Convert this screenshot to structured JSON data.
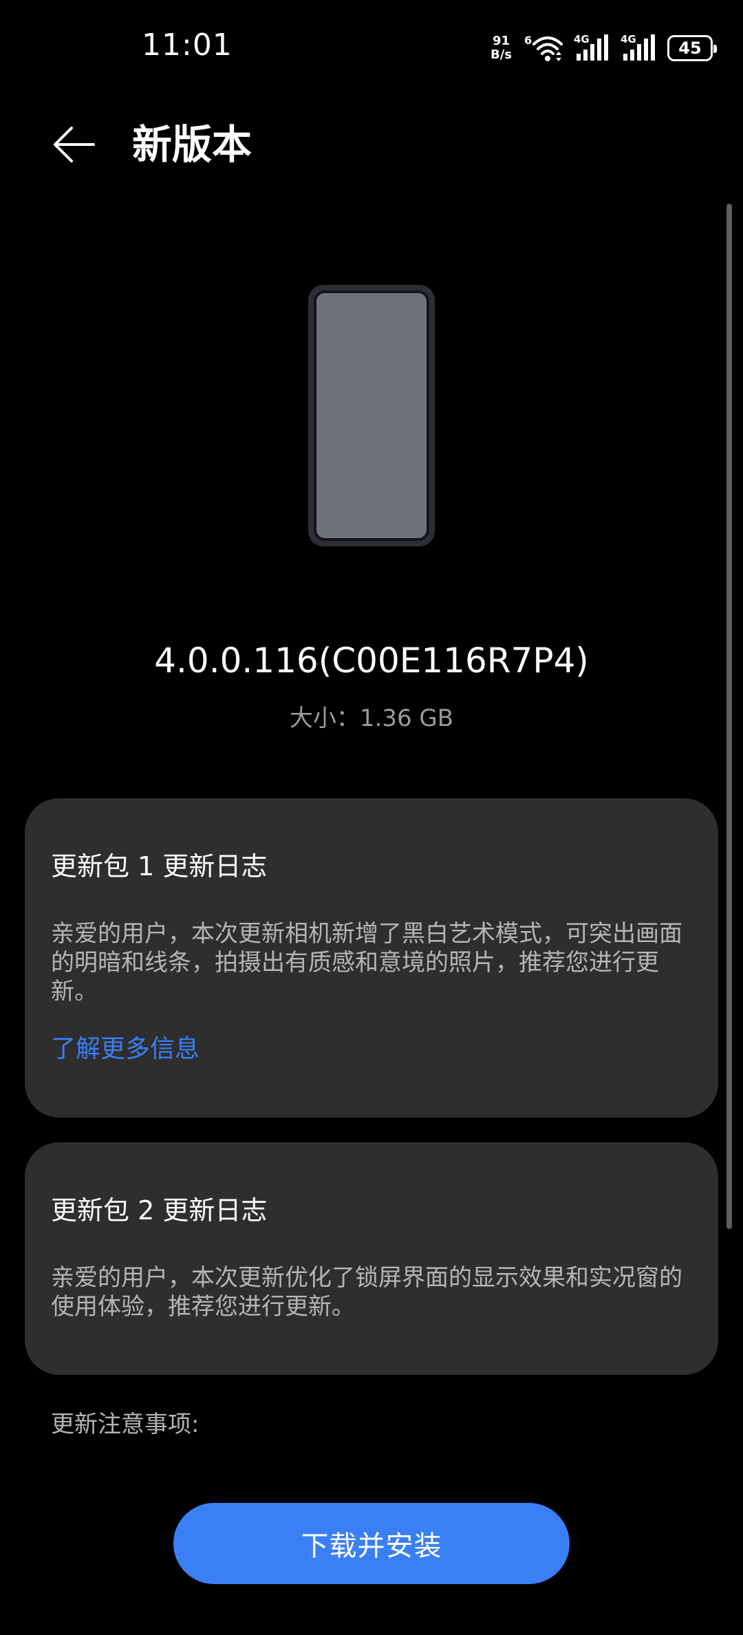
{
  "status_bar": {
    "time": "11:01",
    "net_speed_value": "91",
    "net_speed_unit": "B/s",
    "wifi_badge": "6",
    "signal_1_label": "4G",
    "signal_2_label": "4G",
    "battery_level": "45"
  },
  "header": {
    "title": "新版本"
  },
  "update": {
    "version": "4.0.0.116(C00E116R7P4)",
    "size_text": "大小：1.36 GB"
  },
  "packages": [
    {
      "title": "更新包 1 更新日志",
      "body": "亲爱的用户，本次更新相机新增了黑白艺术模式，可突出画面的明暗和线条，拍摄出有质感和意境的照片，推荐您进行更新。",
      "link": "了解更多信息"
    },
    {
      "title": "更新包 2 更新日志",
      "body": "亲爱的用户，本次更新优化了锁屏界面的显示效果和实况窗的使用体验，推荐您进行更新。"
    }
  ],
  "notes_label": "更新注意事项:",
  "actions": {
    "download_label": "下载并安装"
  },
  "colors": {
    "background": "#000000",
    "card": "#2e2e2e",
    "accent": "#3a7ff5",
    "link": "#3c7ef5"
  },
  "icons": {
    "back": "arrow-left-icon",
    "wifi": "wifi-icon",
    "signal": "cell-signal-icon",
    "battery": "battery-icon"
  }
}
